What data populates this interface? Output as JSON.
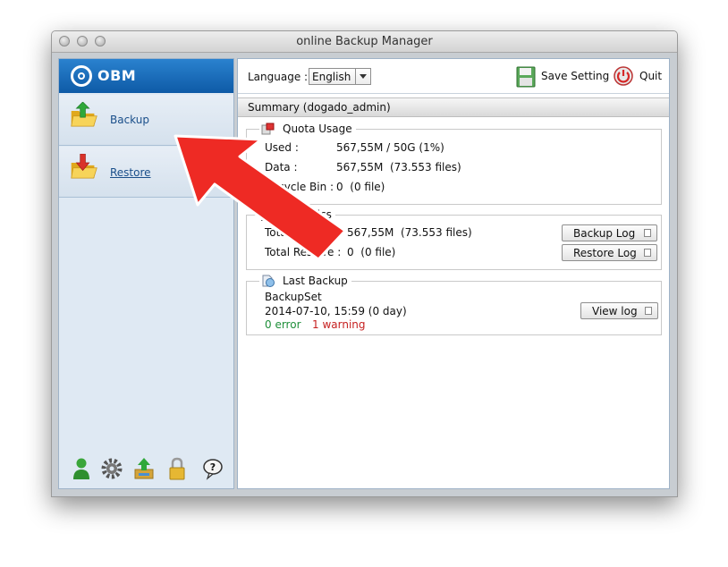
{
  "window": {
    "title": "online Backup Manager"
  },
  "sidebar": {
    "logo": "OBM",
    "items": [
      {
        "label": "Backup",
        "icon": "folder-upload-icon"
      },
      {
        "label": "Restore",
        "icon": "folder-download-icon"
      }
    ],
    "bottom_icons": [
      "user-icon",
      "gear-icon",
      "transfer-icon",
      "lock-icon",
      "help-icon"
    ]
  },
  "toolbar": {
    "language_label": "Language :",
    "language_value": "English",
    "save_label": "Save Setting",
    "quit_label": "Quit"
  },
  "summary": {
    "title": "Summary (dogado_admin)",
    "quota": {
      "title": "Quota Usage",
      "used_label": "Used :",
      "used_value": "567,55M / 50G (1%)",
      "data_label": "Data :",
      "data_value": "567,55M  (73.553 files)",
      "recycle_label": "Recycle Bin :",
      "recycle_value": "0  (0 file)"
    },
    "statistics": {
      "title": "Statistics",
      "total_backup_label": "Total Backup :",
      "total_backup_value": "567,55M  (73.553 files)",
      "total_restore_label": "Total Restore :",
      "total_restore_value": "0  (0 file)",
      "backup_log_button": "Backup Log",
      "restore_log_button": "Restore Log"
    },
    "last_backup": {
      "title": "Last Backup",
      "set_name": "BackupSet",
      "time": "2014-07-10, 15:59 (0 day)",
      "errors": "0 error",
      "warnings": "1 warning",
      "view_log_button": "View log"
    }
  },
  "colors": {
    "annotation_arrow": "#ee2a24",
    "logo_bar": "#1668b8",
    "error_ok": "#1f8f3a",
    "warning": "#c62020"
  }
}
